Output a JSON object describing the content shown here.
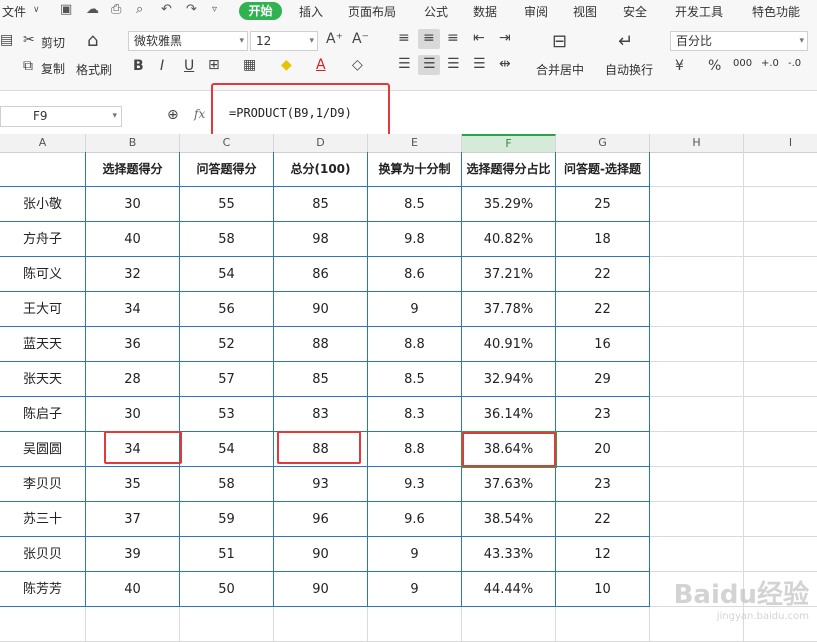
{
  "menubar": {
    "file": "文件",
    "tabs": [
      "开始",
      "插入",
      "页面布局",
      "公式",
      "数据",
      "审阅",
      "视图",
      "安全",
      "开发工具",
      "特色功能"
    ]
  },
  "ribbon": {
    "cut": "剪切",
    "copy": "复制",
    "format_painter": "格式刷",
    "font_name": "微软雅黑",
    "font_size": "12",
    "merge_center": "合并居中",
    "wrap_text": "自动换行",
    "number_format": "百分比",
    "percent": "%",
    "thousands": "000",
    "dec_inc": "+.0",
    "dec_dec": "-.0"
  },
  "formula_bar": {
    "name_box": "F9",
    "fx": "fx",
    "formula": "=PRODUCT(B9,1/D9)"
  },
  "columns": [
    "A",
    "B",
    "C",
    "D",
    "E",
    "F",
    "G",
    "H",
    "I"
  ],
  "table": {
    "headers": [
      "",
      "选择题得分",
      "问答题得分",
      "总分(100)",
      "换算为十分制",
      "选择题得分占比",
      "问答题-选择题"
    ],
    "rows": [
      [
        "张小敬",
        "30",
        "55",
        "85",
        "8.5",
        "35.29%",
        "25"
      ],
      [
        "方舟子",
        "40",
        "58",
        "98",
        "9.8",
        "40.82%",
        "18"
      ],
      [
        "陈可义",
        "32",
        "54",
        "86",
        "8.6",
        "37.21%",
        "22"
      ],
      [
        "王大可",
        "34",
        "56",
        "90",
        "9",
        "37.78%",
        "22"
      ],
      [
        "蓝天天",
        "36",
        "52",
        "88",
        "8.8",
        "40.91%",
        "16"
      ],
      [
        "张天天",
        "28",
        "57",
        "85",
        "8.5",
        "32.94%",
        "29"
      ],
      [
        "陈启子",
        "30",
        "53",
        "83",
        "8.3",
        "36.14%",
        "23"
      ],
      [
        "吴圆圆",
        "34",
        "54",
        "88",
        "8.8",
        "38.64%",
        "20"
      ],
      [
        "李贝贝",
        "35",
        "58",
        "93",
        "9.3",
        "37.63%",
        "23"
      ],
      [
        "苏三十",
        "37",
        "59",
        "96",
        "9.6",
        "38.54%",
        "22"
      ],
      [
        "张贝贝",
        "39",
        "51",
        "90",
        "9",
        "43.33%",
        "12"
      ],
      [
        "陈芳芳",
        "40",
        "50",
        "90",
        "9",
        "44.44%",
        "10"
      ]
    ]
  },
  "watermark": "Baidu经验",
  "watermark_sub": "jingyan.baidu.com",
  "colors": {
    "accent": "#2fb24f",
    "highlight": "#e23a3a",
    "table_border": "#2e75b6"
  }
}
